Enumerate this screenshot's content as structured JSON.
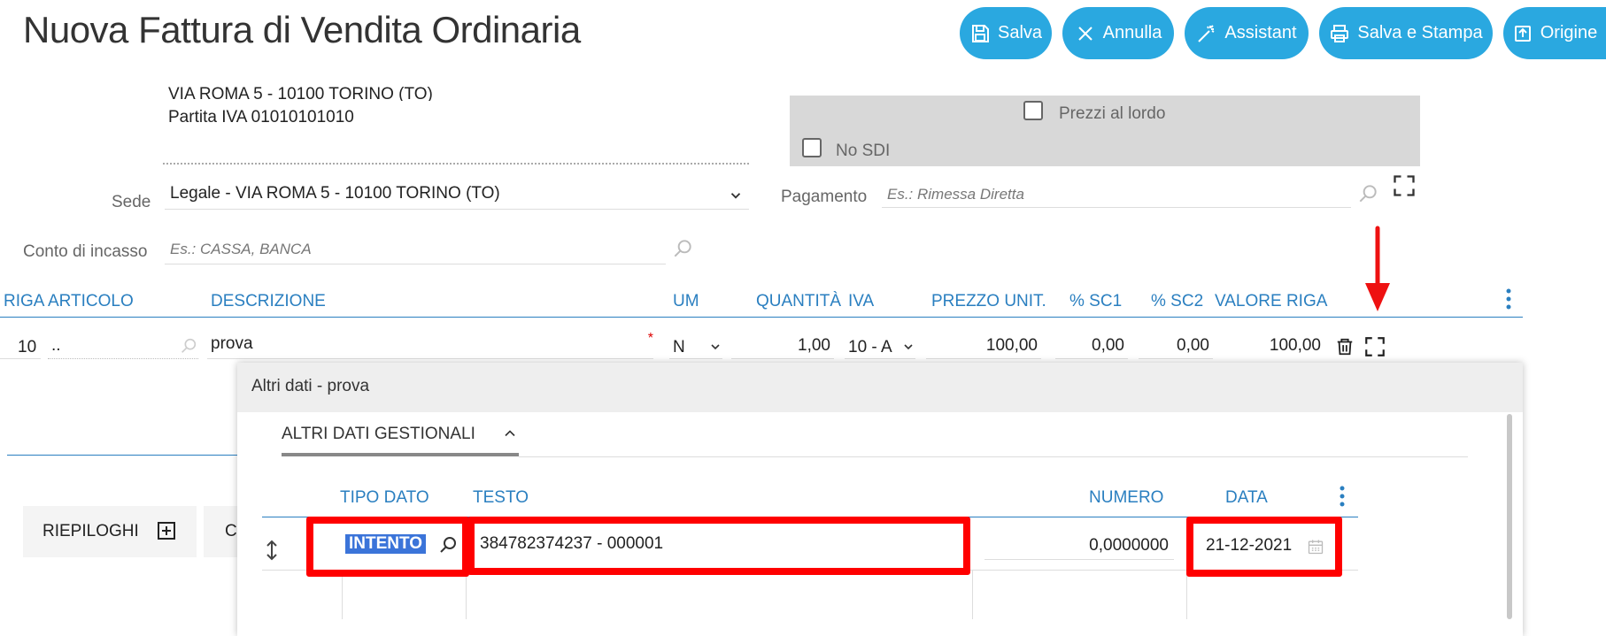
{
  "header": {
    "title": "Nuova Fattura di Vendita Ordinaria",
    "buttons": {
      "save": "Salva",
      "cancel": "Annulla",
      "assistant": "Assistant",
      "save_print": "Salva e Stampa",
      "origin": "Origine"
    }
  },
  "customer": {
    "address_line": "VIA ROMA 5 - 10100 TORINO (TO)",
    "vat": "Partita IVA 01010101010"
  },
  "options": {
    "gross_prices": "Prezzi al lordo",
    "no_sdi": "No SDI"
  },
  "fields": {
    "sede_label": "Sede",
    "sede_value": "Legale - VIA ROMA 5 - 10100 TORINO (TO)",
    "pagamento_label": "Pagamento",
    "pagamento_placeholder": "Es.: Rimessa Diretta",
    "conto_label": "Conto di incasso",
    "conto_placeholder": "Es.: CASSA, BANCA"
  },
  "grid": {
    "columns": {
      "riga": "RIGA",
      "articolo": "ARTICOLO",
      "descrizione": "DESCRIZIONE",
      "um": "UM",
      "quantita": "QUANTITÀ",
      "iva": "IVA",
      "prezzo": "PREZZO UNIT.",
      "sc1": "% SC1",
      "sc2": "% SC2",
      "valore": "VALORE RIGA"
    },
    "row": {
      "riga": "10",
      "articolo": "..",
      "descrizione": "prova",
      "required_mark": "*",
      "um": "N",
      "quantita": "1,00",
      "iva": "10 - A",
      "prezzo": "100,00",
      "sc1": "0,00",
      "sc2": "0,00",
      "valore": "100,00"
    }
  },
  "bottom": {
    "riepiloghi": "RIEPILOGHI",
    "next_tab_initial": "C"
  },
  "modal": {
    "title": "Altri dati - prova",
    "section": "ALTRI DATI GESTIONALI",
    "columns": {
      "tipo": "TIPO DATO",
      "testo": "TESTO",
      "numero": "NUMERO",
      "data": "DATA"
    },
    "row": {
      "tipo": "INTENTO",
      "testo": "384782374237 - 000001",
      "numero": "0,0000000",
      "data": "21-12-2021"
    }
  },
  "colors": {
    "accent": "#2aa8e0",
    "link": "#2a7fc0",
    "highlight": "#ff0000"
  }
}
